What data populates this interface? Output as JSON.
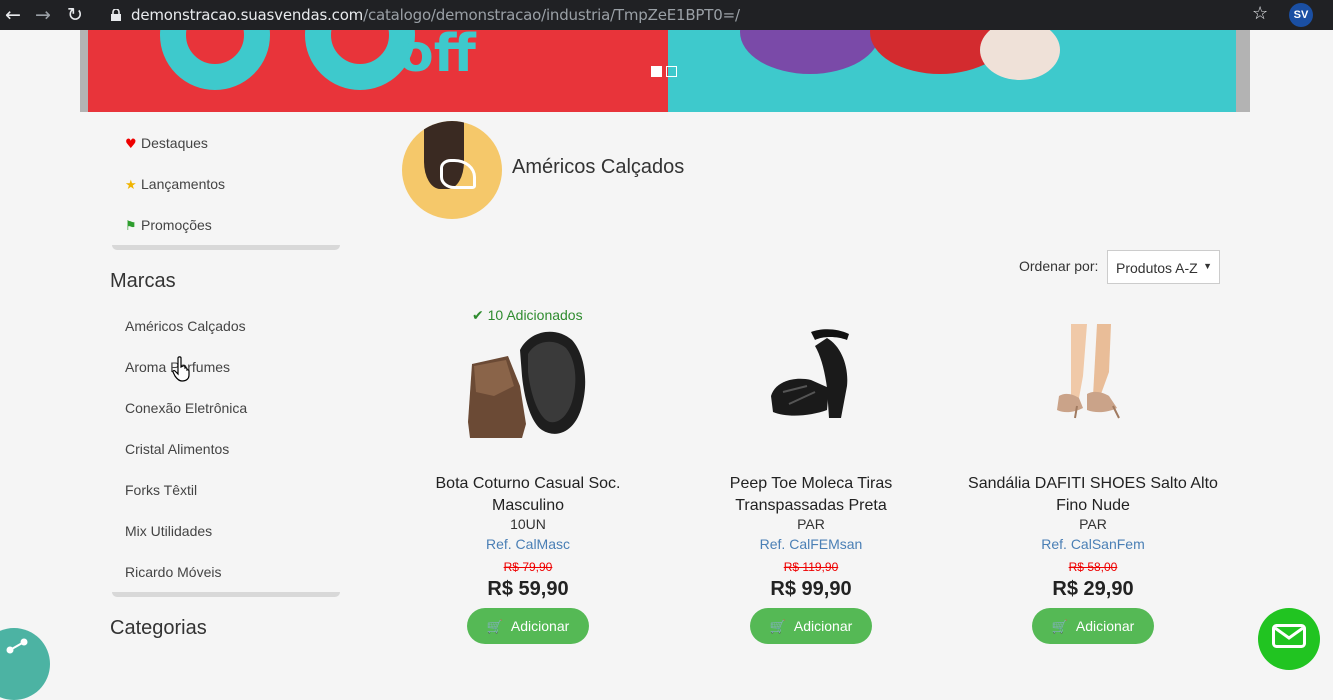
{
  "browser": {
    "url_host": "demonstracao.suasvendas.com",
    "url_path": "/catalogo/demonstracao/industria/TmpZeE1BPT0=/",
    "extension_badge": "SV"
  },
  "banner": {
    "text": "off"
  },
  "sidebar": {
    "quick_links": [
      {
        "label": "Destaques",
        "icon": "heart-icon",
        "color": "#e00000"
      },
      {
        "label": "Lançamentos",
        "icon": "star-icon",
        "color": "#f0b400"
      },
      {
        "label": "Promoções",
        "icon": "tags-icon",
        "color": "#2e9e2e"
      }
    ],
    "brands_heading": "Marcas",
    "brands": [
      "Américos Calçados",
      "Aroma Perfumes",
      "Conexão Eletrônica",
      "Cristal Alimentos",
      "Forks Têxtil",
      "Mix Utilidades",
      "Ricardo Móveis"
    ],
    "categories_heading": "Categorias"
  },
  "store": {
    "name": "Américos Calçados"
  },
  "sort": {
    "label": "Ordenar por:",
    "selected": "Produtos A-Z"
  },
  "added_notice": "10 Adicionados",
  "products": [
    {
      "name": "Bota Coturno Casual Soc. Masculino",
      "unit": "10UN",
      "ref": "Ref. CalMasc",
      "old_price": "R$ 79,90",
      "price": "R$ 59,90",
      "button": "Adicionar"
    },
    {
      "name": "Peep Toe Moleca Tiras Transpassadas Preta",
      "unit": "PAR",
      "ref": "Ref. CalFEMsan",
      "old_price": "R$ 119,90",
      "price": "R$ 99,90",
      "button": "Adicionar"
    },
    {
      "name": "Sandália DAFITI SHOES Salto Alto Fino Nude",
      "unit": "PAR",
      "ref": "Ref. CalSanFem",
      "old_price": "R$ 58,00",
      "price": "R$ 29,90",
      "button": "Adicionar"
    }
  ],
  "colors": {
    "accent_green": "#55b955",
    "link_blue": "#4a7fb5",
    "price_red": "#e00000"
  }
}
